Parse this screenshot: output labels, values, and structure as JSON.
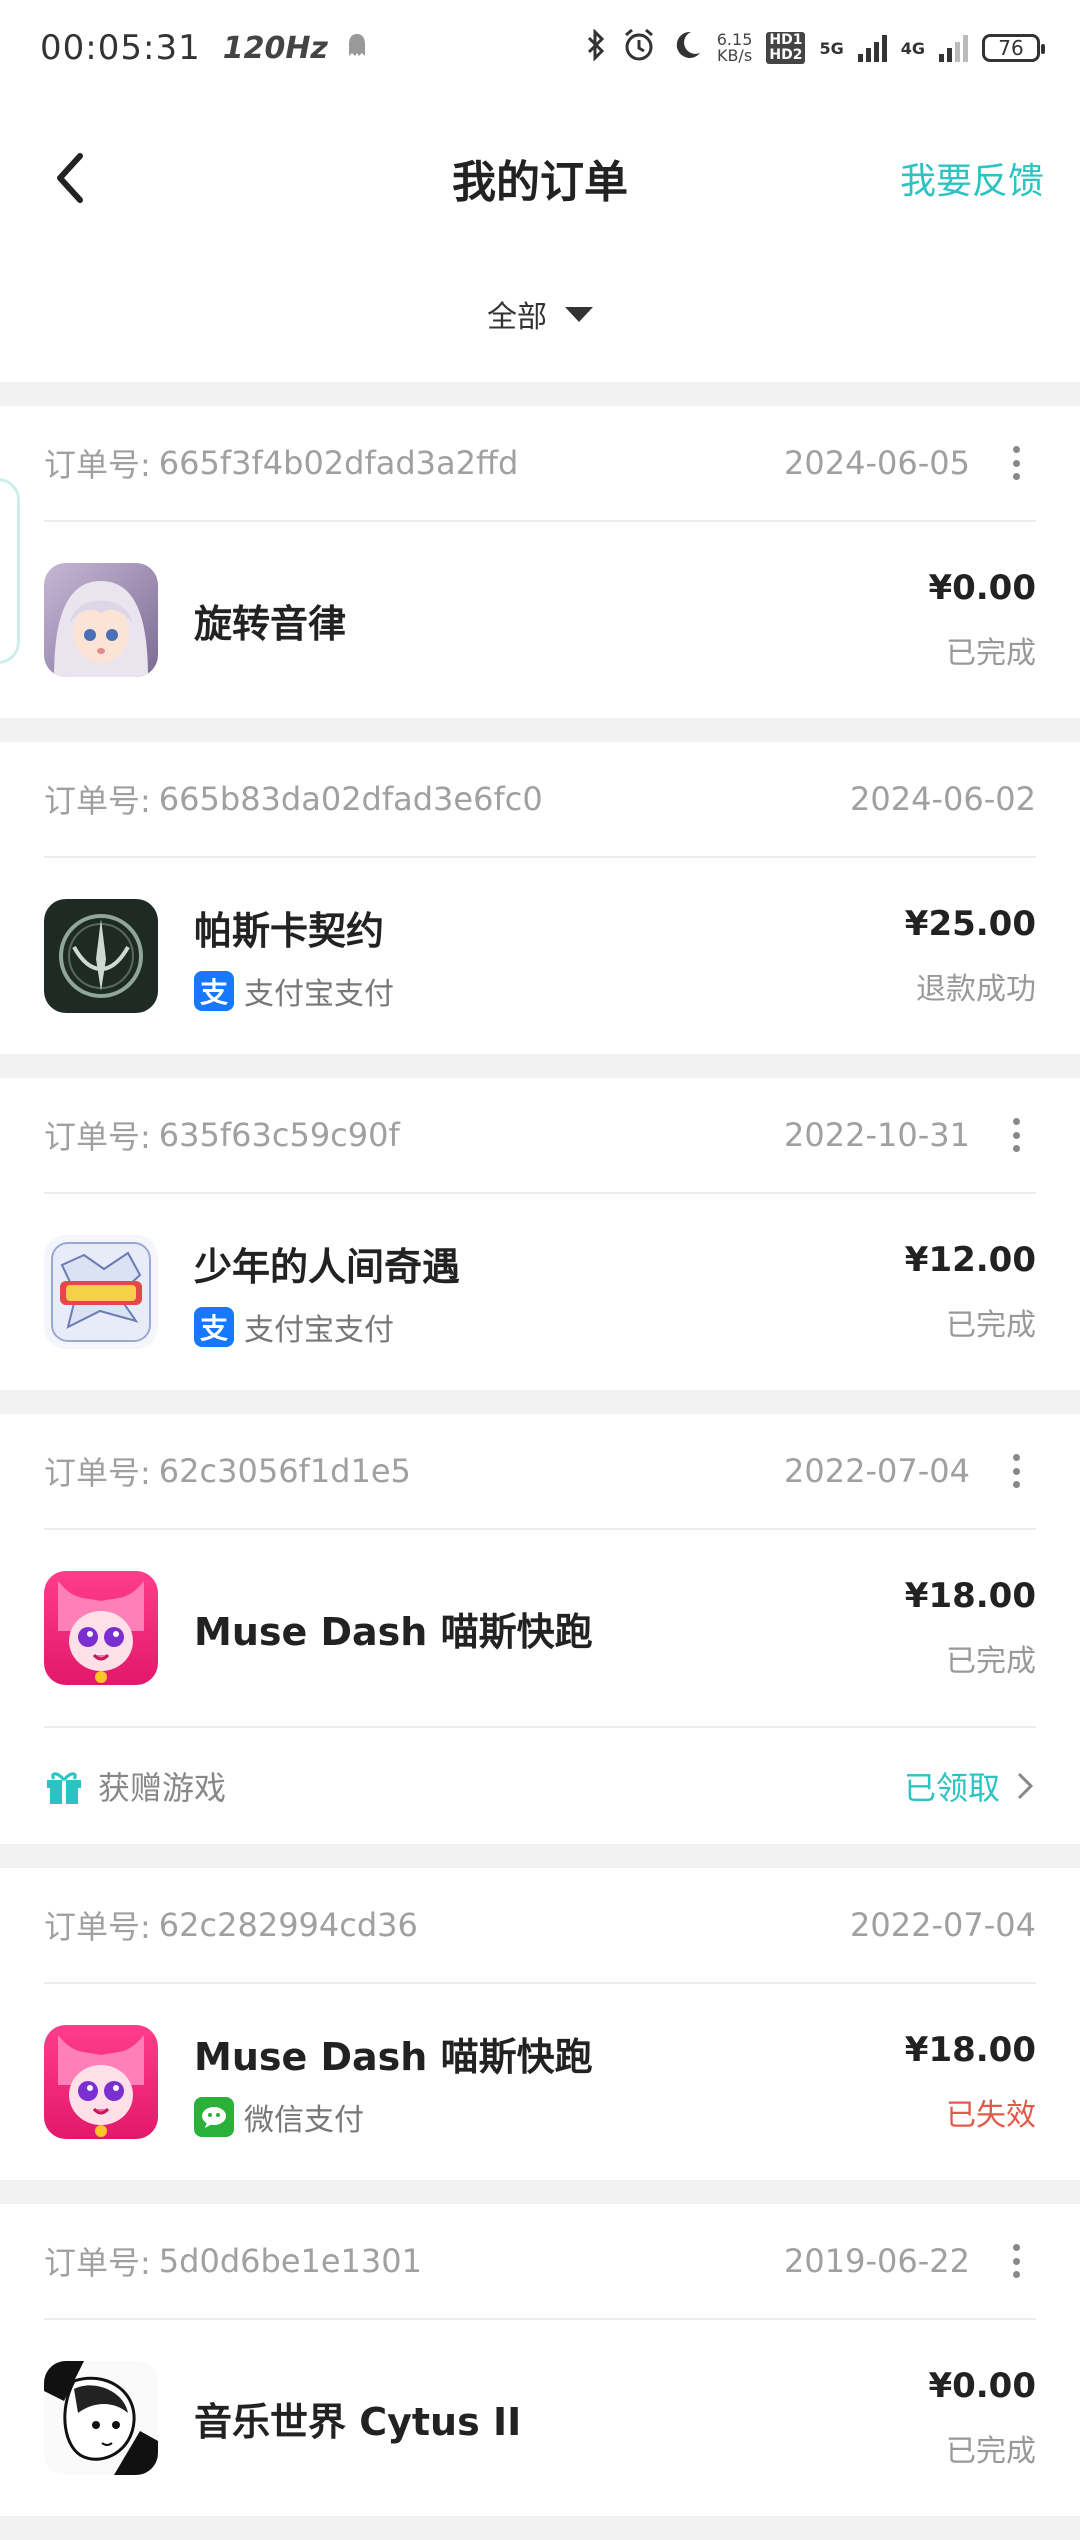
{
  "status_bar": {
    "time": "00:05:31",
    "refresh_rate": "120Hz",
    "net_speed": "6.15",
    "net_unit": "KB/s",
    "hd_tag": "HD1 HD2",
    "gen5": "5G",
    "gen4": "4G",
    "battery": "76"
  },
  "nav": {
    "title": "我的订单",
    "feedback_label": "我要反馈"
  },
  "filter": {
    "selected": "全部"
  },
  "colors": {
    "accent": "#2ec3c3",
    "failed": "#e05a4d",
    "alipay": "#1677ff",
    "wechat": "#2ab13a"
  },
  "orders": [
    {
      "label": "订单号:",
      "id": "665f3f4b02dfad3a2ffd",
      "date": "2024-06-05",
      "has_more": true,
      "app": "旋转音律",
      "icon": "rotaeno-icon",
      "payment": "",
      "price": "¥0.00",
      "status": "已完成"
    },
    {
      "label": "订单号:",
      "id": "665b83da02dfad3e6fc0",
      "date": "2024-06-02",
      "has_more": false,
      "app": "帕斯卡契约",
      "icon": "pascal-contract-icon",
      "payment": "支付宝支付",
      "price": "¥25.00",
      "status": "退款成功"
    },
    {
      "label": "订单号:",
      "id": "635f63c59c90f",
      "date": "2022-10-31",
      "has_more": true,
      "app": "少年的人间奇遇",
      "icon": "youth-adventure-icon",
      "payment": "支付宝支付",
      "price": "¥12.00",
      "status": "已完成"
    },
    {
      "label": "订单号:",
      "id": "62c3056f1d1e5",
      "date": "2022-07-04",
      "has_more": true,
      "app": "Muse Dash 喵斯快跑",
      "icon": "muse-dash-icon",
      "payment": "",
      "price": "¥18.00",
      "status": "已完成",
      "gift": {
        "label": "获赠游戏",
        "status": "已领取"
      }
    },
    {
      "label": "订单号:",
      "id": "62c282994cd36",
      "date": "2022-07-04",
      "has_more": false,
      "app": "Muse Dash 喵斯快跑",
      "icon": "muse-dash-icon",
      "payment": "微信支付",
      "price": "¥18.00",
      "status": "已失效"
    },
    {
      "label": "订单号:",
      "id": "5d0d6be1e1301",
      "date": "2019-06-22",
      "has_more": true,
      "app": "音乐世界 Cytus II",
      "icon": "cytus-ii-icon",
      "payment": "",
      "price": "¥0.00",
      "status": "已完成"
    }
  ]
}
